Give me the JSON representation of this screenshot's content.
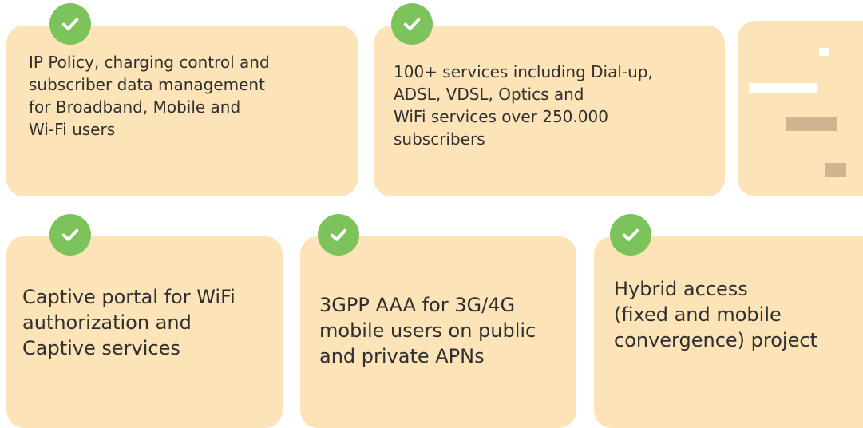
{
  "colors": {
    "card_bg": "#fde3b8",
    "check_bg": "#7cc35b",
    "text": "#2f2f2f"
  },
  "cards": [
    {
      "text": "IP Policy, charging control and\nsubscriber data management\nfor Broadband, Mobile and\nWi-Fi users",
      "icon": "check-icon"
    },
    {
      "text": "100+ services including Dial-up,\nADSL, VDSL, Optics and\nWiFi services over 250.000\nsubscribers",
      "icon": "check-icon"
    },
    {
      "text": "",
      "icon": ""
    },
    {
      "text": "Captive portal for WiFi\nauthorization and\nCaptive services",
      "icon": "check-icon"
    },
    {
      "text": "3GPP AAA for 3G/4G\nmobile users on public\nand private APNs",
      "icon": "check-icon"
    },
    {
      "text": "Hybrid access\n(fixed and mobile\nconvergence) project",
      "icon": "check-icon"
    }
  ]
}
